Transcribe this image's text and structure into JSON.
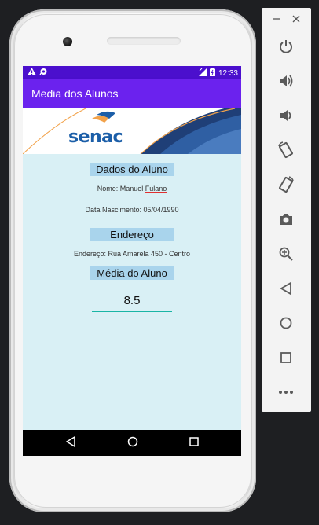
{
  "status_bar": {
    "time": "12:33"
  },
  "app_bar": {
    "title": "Media dos Alunos"
  },
  "banner": {
    "logo_text": "senac"
  },
  "sections": {
    "student_header": "Dados do Aluno",
    "name_label": "Nome: Manuel ",
    "name_misspelled": "Fulano",
    "birth_line": "Data Nascimento: 05/04/1990",
    "address_header": "Endereço",
    "address_line": "Endereço: Rua Amarela 450 - Centro",
    "average_header": "Média do Aluno",
    "average_value": "8.5"
  },
  "colors": {
    "status_bar": "#4b0fcd",
    "app_bar": "#6b22ee",
    "content_bg": "#d9f0f5",
    "section_label_bg": "#a9d4ec",
    "input_underline": "#19b5a5"
  },
  "icons": {
    "status_left": [
      "warning-icon",
      "notification-icon"
    ],
    "status_right": [
      "signal-icon",
      "battery-icon"
    ],
    "nav": [
      "back-icon",
      "home-icon",
      "recents-icon"
    ],
    "emulator_panel": [
      "minimize-icon",
      "close-icon",
      "power-icon",
      "volume-up-icon",
      "volume-down-icon",
      "rotate-left-icon",
      "rotate-right-icon",
      "camera-icon",
      "zoom-icon",
      "back-icon",
      "home-icon",
      "overview-icon",
      "more-icon"
    ]
  }
}
